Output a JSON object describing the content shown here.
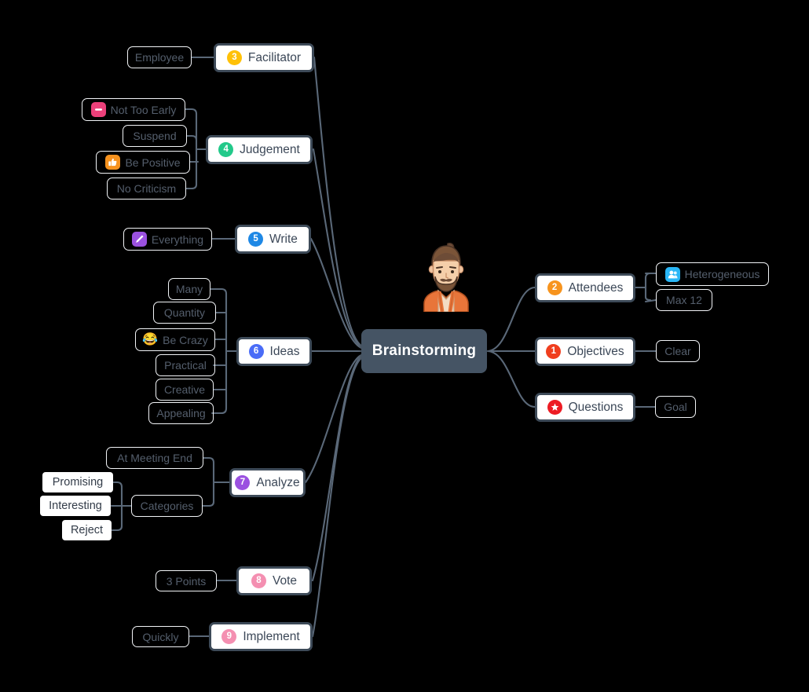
{
  "map": {
    "root": {
      "label": "Brainstorming"
    },
    "avatar": {
      "name": "bearded-man-avatar"
    },
    "branches": [
      {
        "id": "objectives",
        "label": "Objectives",
        "number": "1",
        "badge_color": "#f03e1e",
        "side": "right",
        "children": [
          {
            "label": "Clear"
          }
        ]
      },
      {
        "id": "attendees",
        "label": "Attendees",
        "number": "2",
        "badge_color": "#f7941e",
        "side": "right",
        "children": [
          {
            "label": "Heterogeneous",
            "icon": "people-icon",
            "icon_color": "#29b6f6"
          },
          {
            "label": "Max 12"
          }
        ]
      },
      {
        "id": "questions",
        "label": "Questions",
        "number": "star",
        "badge_color": "#ed1c24",
        "side": "right",
        "children": [
          {
            "label": "Goal"
          }
        ]
      },
      {
        "id": "facilitator",
        "label": "Facilitator",
        "number": "3",
        "badge_color": "#ffc107",
        "side": "left",
        "children": [
          {
            "label": "Employee"
          }
        ]
      },
      {
        "id": "judgement",
        "label": "Judgement",
        "number": "4",
        "badge_color": "#22c98a",
        "side": "left",
        "children": [
          {
            "label": "Not Too Early",
            "icon": "no-entry-icon",
            "icon_color": "#ec407a"
          },
          {
            "label": "Suspend"
          },
          {
            "label": "Be Positive",
            "icon": "thumbs-up-icon",
            "icon_color": "#f6921e"
          },
          {
            "label": "No Criticism"
          }
        ]
      },
      {
        "id": "write",
        "label": "Write",
        "number": "5",
        "badge_color": "#1e88e5",
        "side": "left",
        "children": [
          {
            "label": "Everything",
            "icon": "pen-icon",
            "icon_color": "#9b51e0"
          }
        ]
      },
      {
        "id": "ideas",
        "label": "Ideas",
        "number": "6",
        "badge_color": "#4a6cf7",
        "side": "left",
        "children": [
          {
            "label": "Many"
          },
          {
            "label": "Quantity"
          },
          {
            "label": "Be Crazy",
            "icon": "laughing-emoji",
            "emoji": "😂"
          },
          {
            "label": "Practical"
          },
          {
            "label": "Creative"
          },
          {
            "label": "Appealing"
          }
        ]
      },
      {
        "id": "analyze",
        "label": "Analyze",
        "number": "7",
        "badge_color": "#9b51e0",
        "side": "left",
        "children": [
          {
            "label": "At Meeting End"
          },
          {
            "label": "Categories",
            "children": [
              {
                "label": "Promising"
              },
              {
                "label": "Interesting"
              },
              {
                "label": "Reject"
              }
            ]
          }
        ]
      },
      {
        "id": "vote",
        "label": "Vote",
        "number": "8",
        "badge_color": "#f48fb1",
        "side": "left",
        "children": [
          {
            "label": "3 Points"
          }
        ]
      },
      {
        "id": "implement",
        "label": "Implement",
        "number": "9",
        "badge_color": "#f48fb1",
        "side": "left",
        "children": [
          {
            "label": "Quickly"
          }
        ]
      }
    ]
  },
  "colors": {
    "background": "#000000",
    "root_fill": "#455464",
    "node_border": "#3d4a58",
    "edge": "#5a6878",
    "leaf_text": "#555f6d"
  }
}
